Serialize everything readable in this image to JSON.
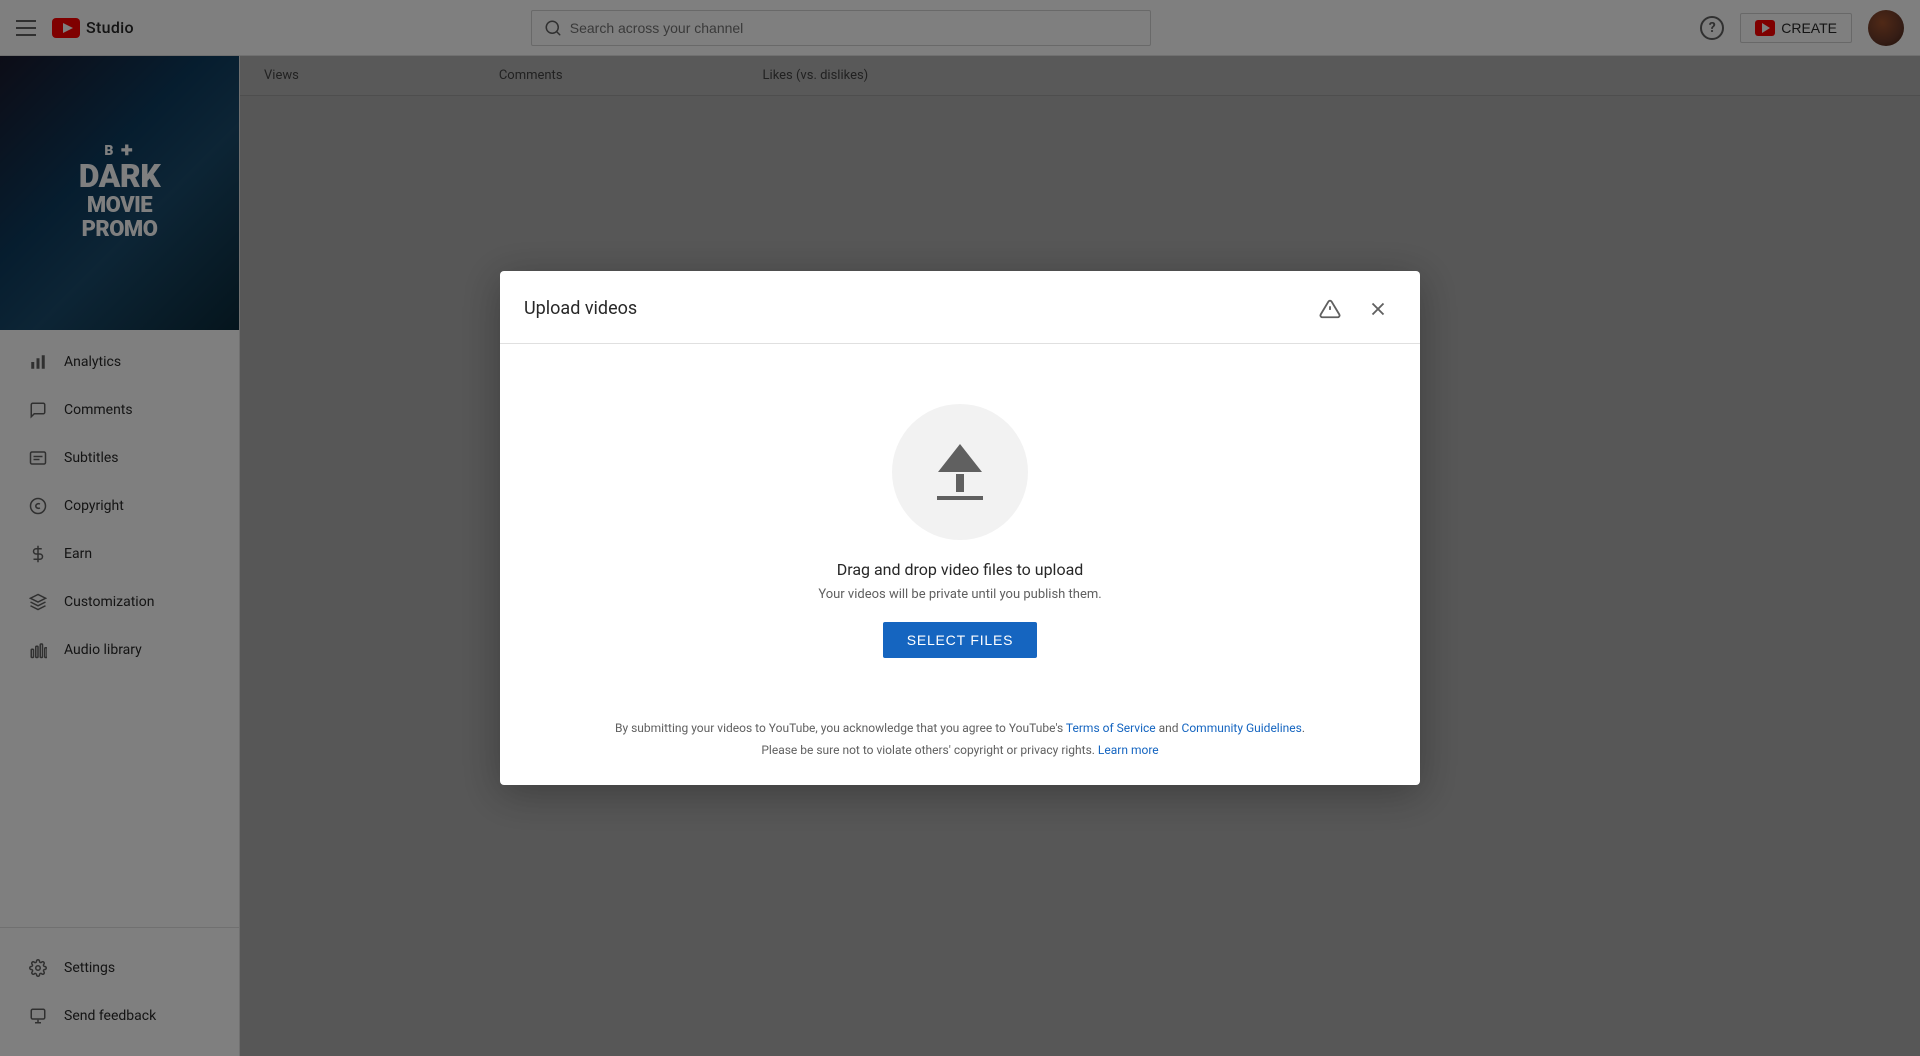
{
  "topNav": {
    "hamburger_label": "Menu",
    "logo_text": "Studio",
    "search_placeholder": "Search across your channel",
    "help_label": "?",
    "create_label": "CREATE",
    "avatar_label": "User avatar"
  },
  "sidebar": {
    "channel_name": "Dark Movie Promo",
    "promo_lines": [
      "B+",
      "DARK",
      "MOVIE",
      "PROMO"
    ],
    "items": [
      {
        "id": "analytics",
        "label": "Analytics",
        "icon": "bar-chart-icon"
      },
      {
        "id": "comments",
        "label": "Comments",
        "icon": "comment-icon"
      },
      {
        "id": "subtitles",
        "label": "Subtitles",
        "icon": "subtitles-icon"
      },
      {
        "id": "copyright",
        "label": "Copyright",
        "icon": "copyright-icon"
      },
      {
        "id": "earn",
        "label": "Earn",
        "icon": "dollar-icon"
      },
      {
        "id": "customization",
        "label": "Customization",
        "icon": "customization-icon"
      },
      {
        "id": "audio-library",
        "label": "Audio library",
        "icon": "audio-icon"
      }
    ],
    "bottom_items": [
      {
        "id": "settings",
        "label": "Settings",
        "icon": "settings-icon"
      },
      {
        "id": "send-feedback",
        "label": "Send feedback",
        "icon": "feedback-icon"
      }
    ]
  },
  "modal": {
    "title": "Upload videos",
    "drag_drop_text": "Drag and drop video files to upload",
    "private_notice": "Your videos will be private until you publish them.",
    "select_files_label": "SELECT FILES",
    "legal_text_before": "By submitting your videos to YouTube, you acknowledge that you agree to YouTube's ",
    "terms_label": "Terms of Service",
    "and_text": " and ",
    "community_label": "Community Guidelines",
    "legal_text_after": ".\nPlease be sure not to violate others' copyright or privacy rights. ",
    "learn_more_label": "Learn more",
    "close_label": "Close",
    "alert_label": "Alert"
  },
  "background": {
    "col1": "Views",
    "col2": "Comments",
    "col3": "Likes (vs. dislikes)"
  }
}
